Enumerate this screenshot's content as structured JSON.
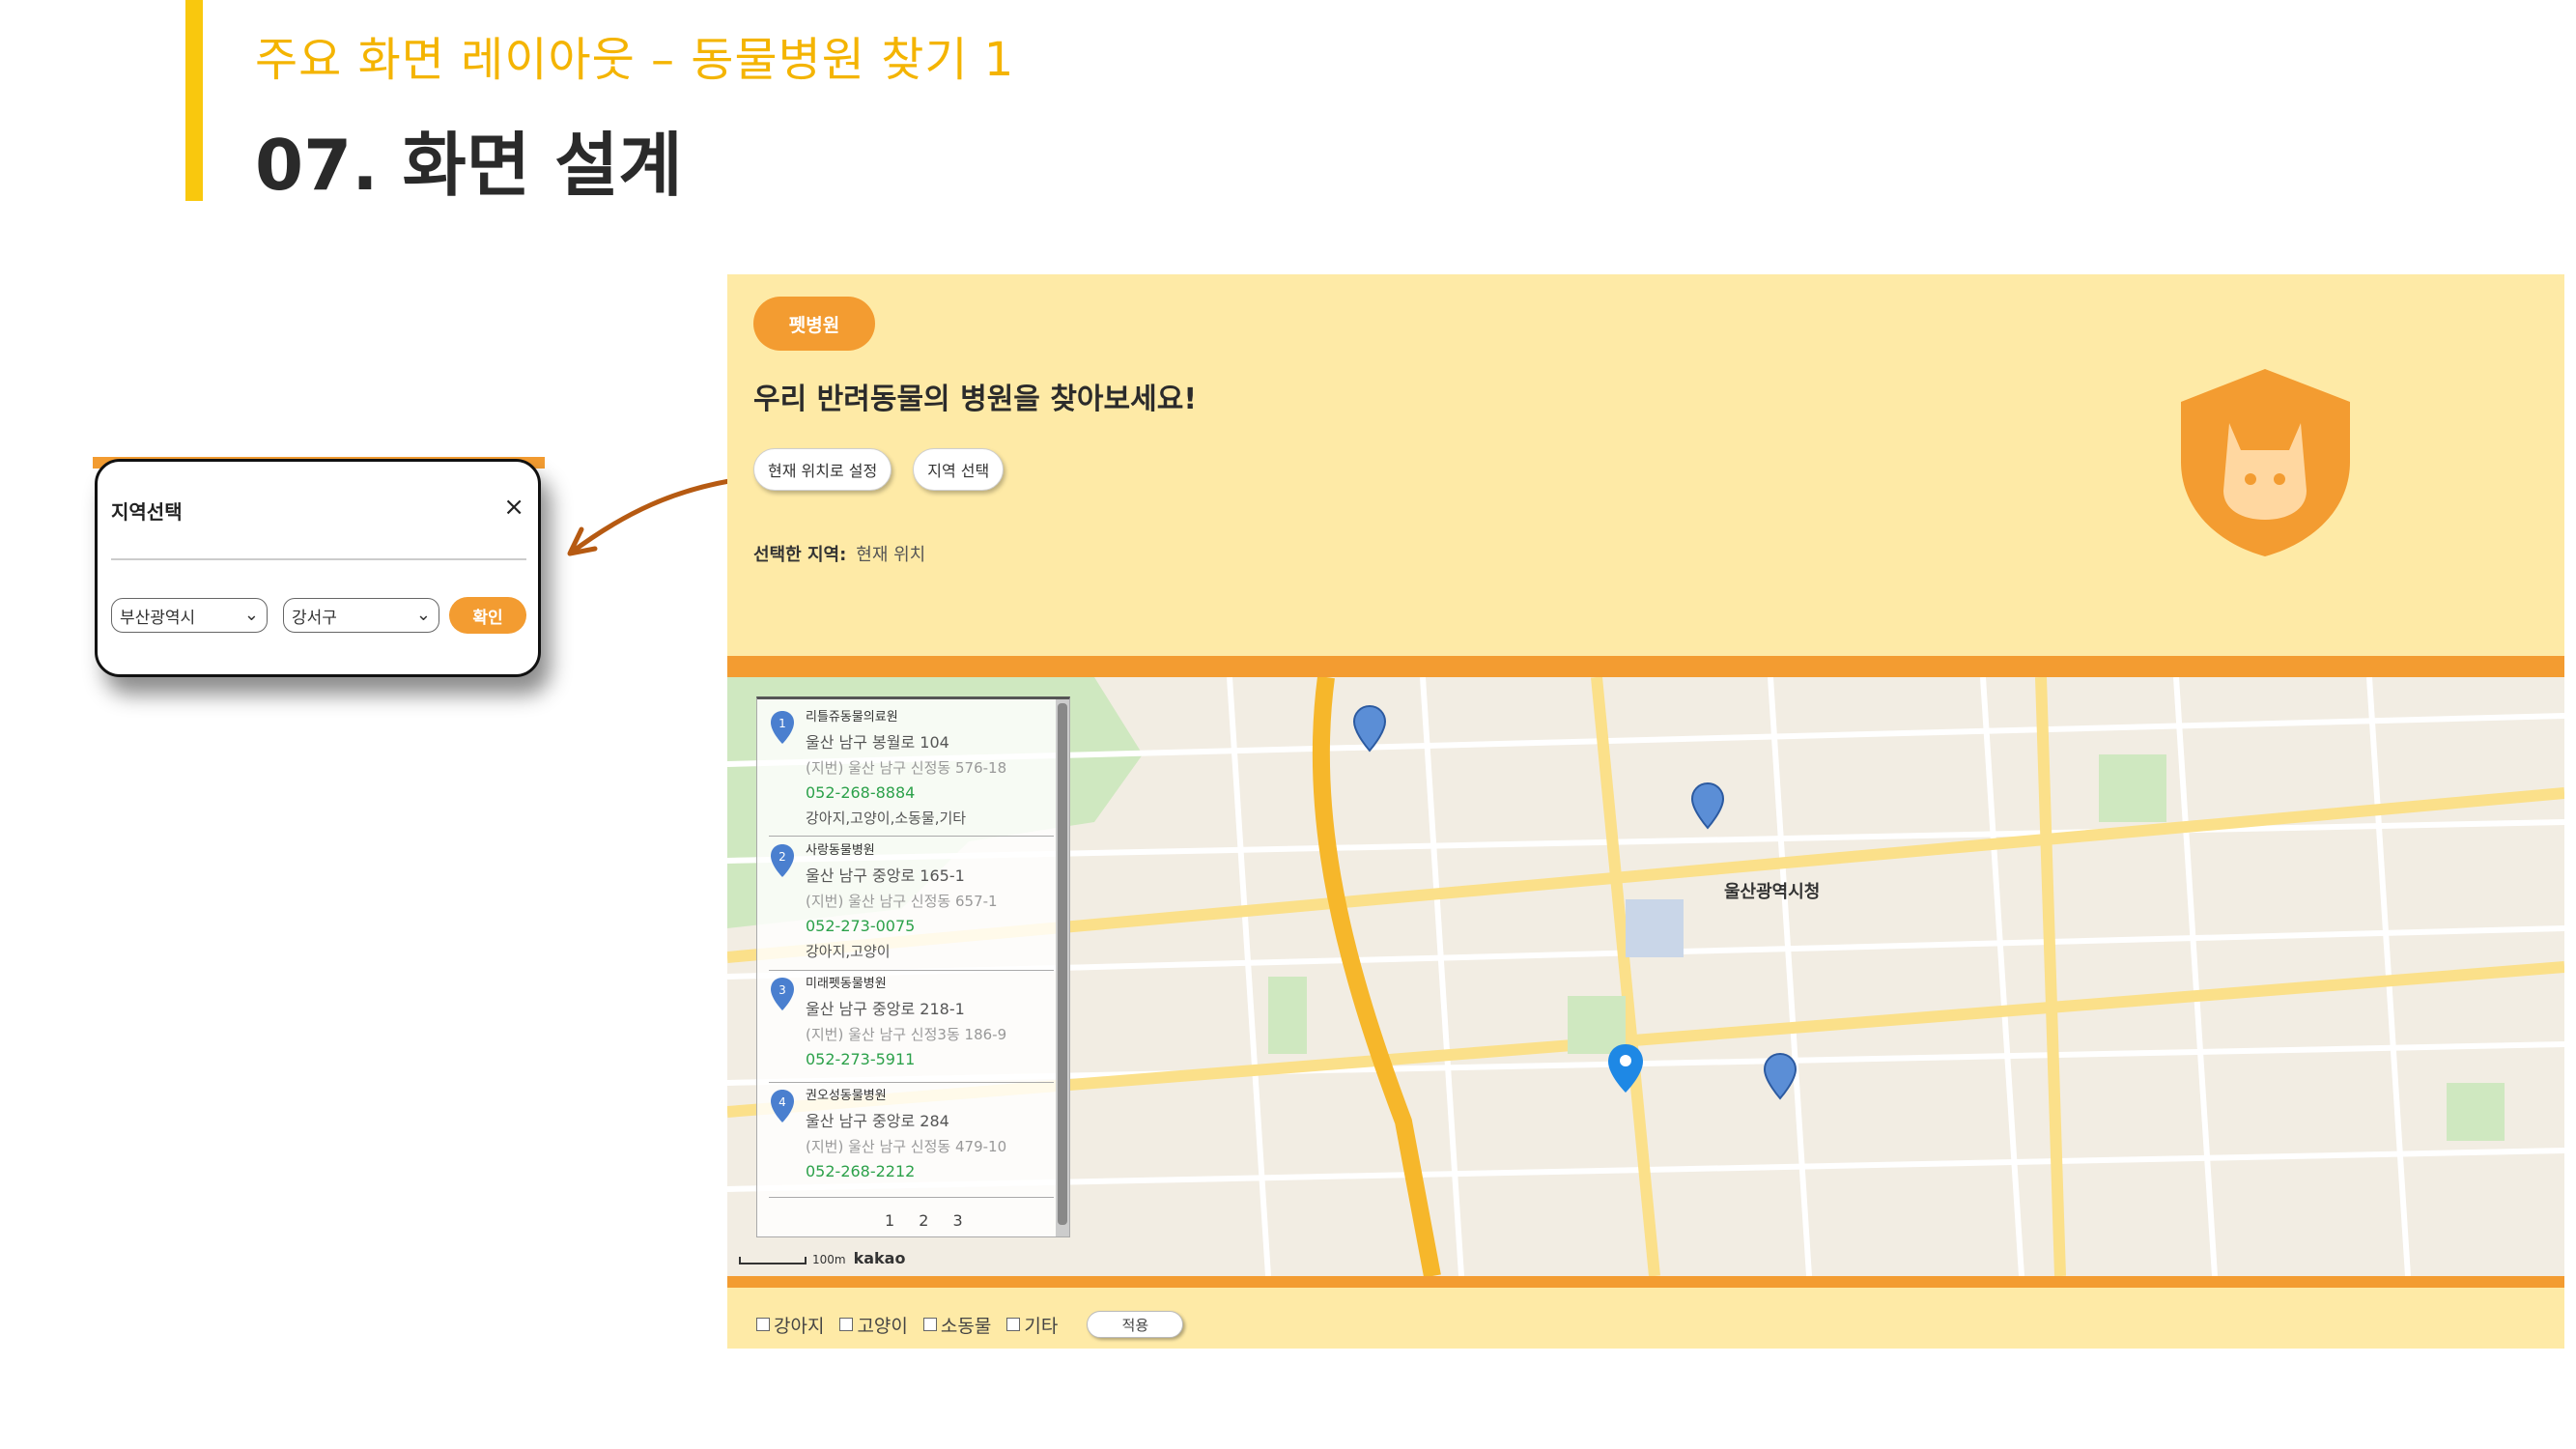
{
  "slide": {
    "subtitle": "주요 화면 레이아웃 – 동물병원 찾기 1",
    "title": "07. 화면 설계"
  },
  "modal": {
    "title": "지역선택",
    "close_icon": "×",
    "city_value": "부산광역시",
    "district_value": "강서구",
    "confirm_label": "확인"
  },
  "app": {
    "logo_label": "펫병원",
    "headline": "우리 반려동물의 병원을 찾아보세요!",
    "buttons": {
      "current_location": "현재 위치로 설정",
      "select_region": "지역 선택"
    },
    "region": {
      "label": "선택한 지역:",
      "value": "현재 위치"
    },
    "map": {
      "center_label": "울산광역시청",
      "scale_label": "100m",
      "provider": "kakao"
    },
    "hospitals": [
      {
        "num": "1",
        "name": "리틀쥬동물의료원",
        "address": "울산 남구 봉월로 104",
        "old_address": "(지번) 울산 남구 신정동 576-18",
        "phone": "052-268-8884",
        "types": "강아지,고양이,소동물,기타"
      },
      {
        "num": "2",
        "name": "사랑동물병원",
        "address": "울산 남구 중앙로 165-1",
        "old_address": "(지번) 울산 남구 신정동 657-1",
        "phone": "052-273-0075",
        "types": "강아지,고양이"
      },
      {
        "num": "3",
        "name": "미래펫동물병원",
        "address": "울산 남구 중앙로 218-1",
        "old_address": "(지번) 울산 남구 신정3동 186-9",
        "phone": "052-273-5911",
        "types": ""
      },
      {
        "num": "4",
        "name": "권오성동물병원",
        "address": "울산 남구 중앙로 284",
        "old_address": "(지번) 울산 남구 신정동 479-10",
        "phone": "052-268-2212",
        "types": ""
      }
    ],
    "pagination": "1 2 3",
    "filters": {
      "dog": "강아지",
      "cat": "고양이",
      "small": "소동물",
      "other": "기타",
      "apply_label": "적용"
    },
    "colors": {
      "accent": "#f39c31",
      "panel_bg": "#feeaa6",
      "phone": "#2ca14a"
    }
  }
}
